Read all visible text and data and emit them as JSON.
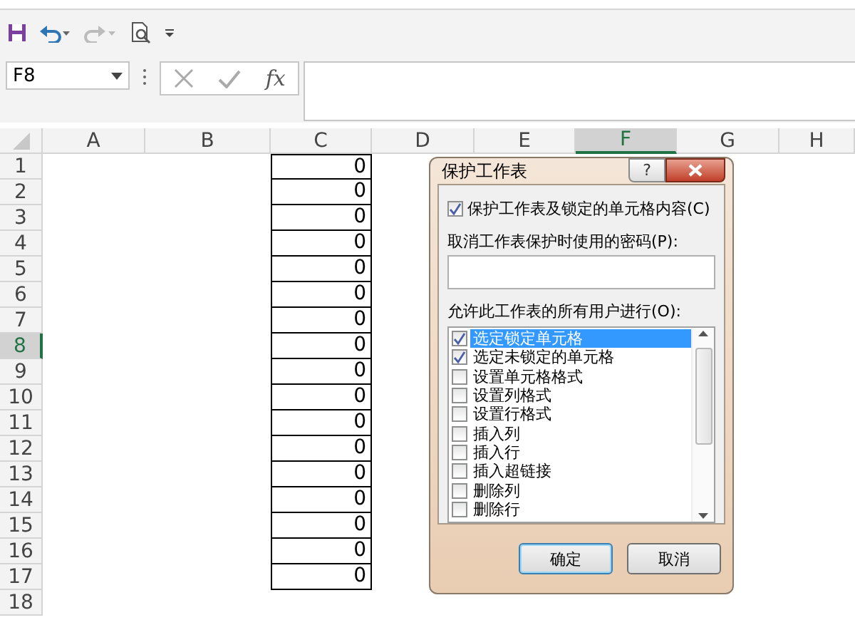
{
  "toolbar": {
    "name_box": "F8",
    "fx": "fx"
  },
  "sheet": {
    "columns": [
      {
        "label": "A",
        "selected": false
      },
      {
        "label": "B",
        "selected": false
      },
      {
        "label": "C",
        "selected": false
      },
      {
        "label": "D",
        "selected": false
      },
      {
        "label": "E",
        "selected": false
      },
      {
        "label": "F",
        "selected": true
      },
      {
        "label": "G",
        "selected": false
      },
      {
        "label": "H",
        "selected": false
      }
    ],
    "rows": [
      {
        "label": "1",
        "selected": false,
        "c": "0"
      },
      {
        "label": "2",
        "selected": false,
        "c": "0"
      },
      {
        "label": "3",
        "selected": false,
        "c": "0"
      },
      {
        "label": "4",
        "selected": false,
        "c": "0"
      },
      {
        "label": "5",
        "selected": false,
        "c": "0"
      },
      {
        "label": "6",
        "selected": false,
        "c": "0"
      },
      {
        "label": "7",
        "selected": false,
        "c": "0"
      },
      {
        "label": "8",
        "selected": true,
        "c": "0"
      },
      {
        "label": "9",
        "selected": false,
        "c": "0"
      },
      {
        "label": "10",
        "selected": false,
        "c": "0"
      },
      {
        "label": "11",
        "selected": false,
        "c": "0"
      },
      {
        "label": "12",
        "selected": false,
        "c": "0"
      },
      {
        "label": "13",
        "selected": false,
        "c": "0"
      },
      {
        "label": "14",
        "selected": false,
        "c": "0"
      },
      {
        "label": "15",
        "selected": false,
        "c": "0"
      },
      {
        "label": "16",
        "selected": false,
        "c": "0"
      },
      {
        "label": "17",
        "selected": false,
        "c": "0"
      },
      {
        "label": "18",
        "selected": false
      }
    ]
  },
  "dialog": {
    "title": "保护工作表",
    "help": "?",
    "protect": {
      "label": "保护工作表及锁定的单元格内容(C)",
      "checked": true
    },
    "password_label": "取消工作表保护时使用的密码(P):",
    "allow_label": "允许此工作表的所有用户进行(O):",
    "permissions": [
      {
        "label": "选定锁定单元格",
        "checked": true,
        "selected": true
      },
      {
        "label": "选定未锁定的单元格",
        "checked": true,
        "selected": false
      },
      {
        "label": "设置单元格格式",
        "checked": false,
        "selected": false
      },
      {
        "label": "设置列格式",
        "checked": false,
        "selected": false
      },
      {
        "label": "设置行格式",
        "checked": false,
        "selected": false
      },
      {
        "label": "插入列",
        "checked": false,
        "selected": false
      },
      {
        "label": "插入行",
        "checked": false,
        "selected": false
      },
      {
        "label": "插入超链接",
        "checked": false,
        "selected": false
      },
      {
        "label": "删除列",
        "checked": false,
        "selected": false
      },
      {
        "label": "删除行",
        "checked": false,
        "selected": false
      }
    ],
    "buttons": [
      {
        "label": "确定",
        "default": true
      },
      {
        "label": "取消",
        "default": false
      }
    ]
  }
}
